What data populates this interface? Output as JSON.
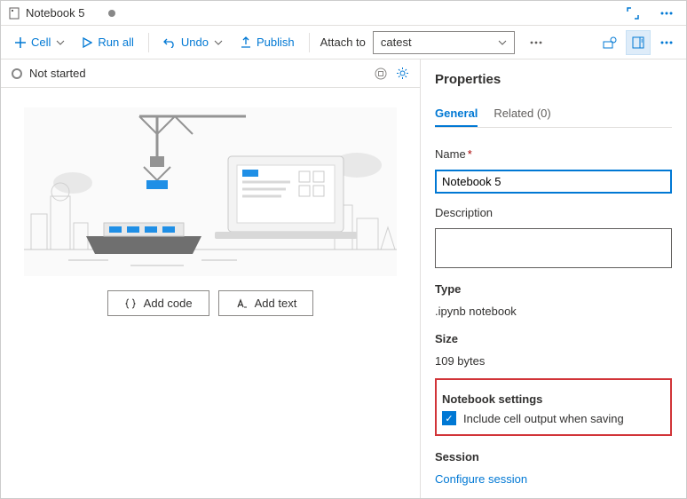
{
  "titlebar": {
    "title": "Notebook 5"
  },
  "toolbar": {
    "cell": "Cell",
    "run_all": "Run all",
    "undo": "Undo",
    "publish": "Publish",
    "attach_label": "Attach to",
    "attach_value": "catest"
  },
  "status": {
    "label": "Not started"
  },
  "actions": {
    "add_code": "Add code",
    "add_text": "Add text"
  },
  "panel": {
    "title": "Properties",
    "tabs": {
      "general": "General",
      "related": "Related (0)"
    },
    "name_label": "Name",
    "name_value": "Notebook 5",
    "description_label": "Description",
    "type_label": "Type",
    "type_value": ".ipynb notebook",
    "size_label": "Size",
    "size_value": "109 bytes",
    "settings_label": "Notebook settings",
    "checkbox_label": "Include cell output when saving",
    "session_label": "Session",
    "session_link": "Configure session"
  }
}
